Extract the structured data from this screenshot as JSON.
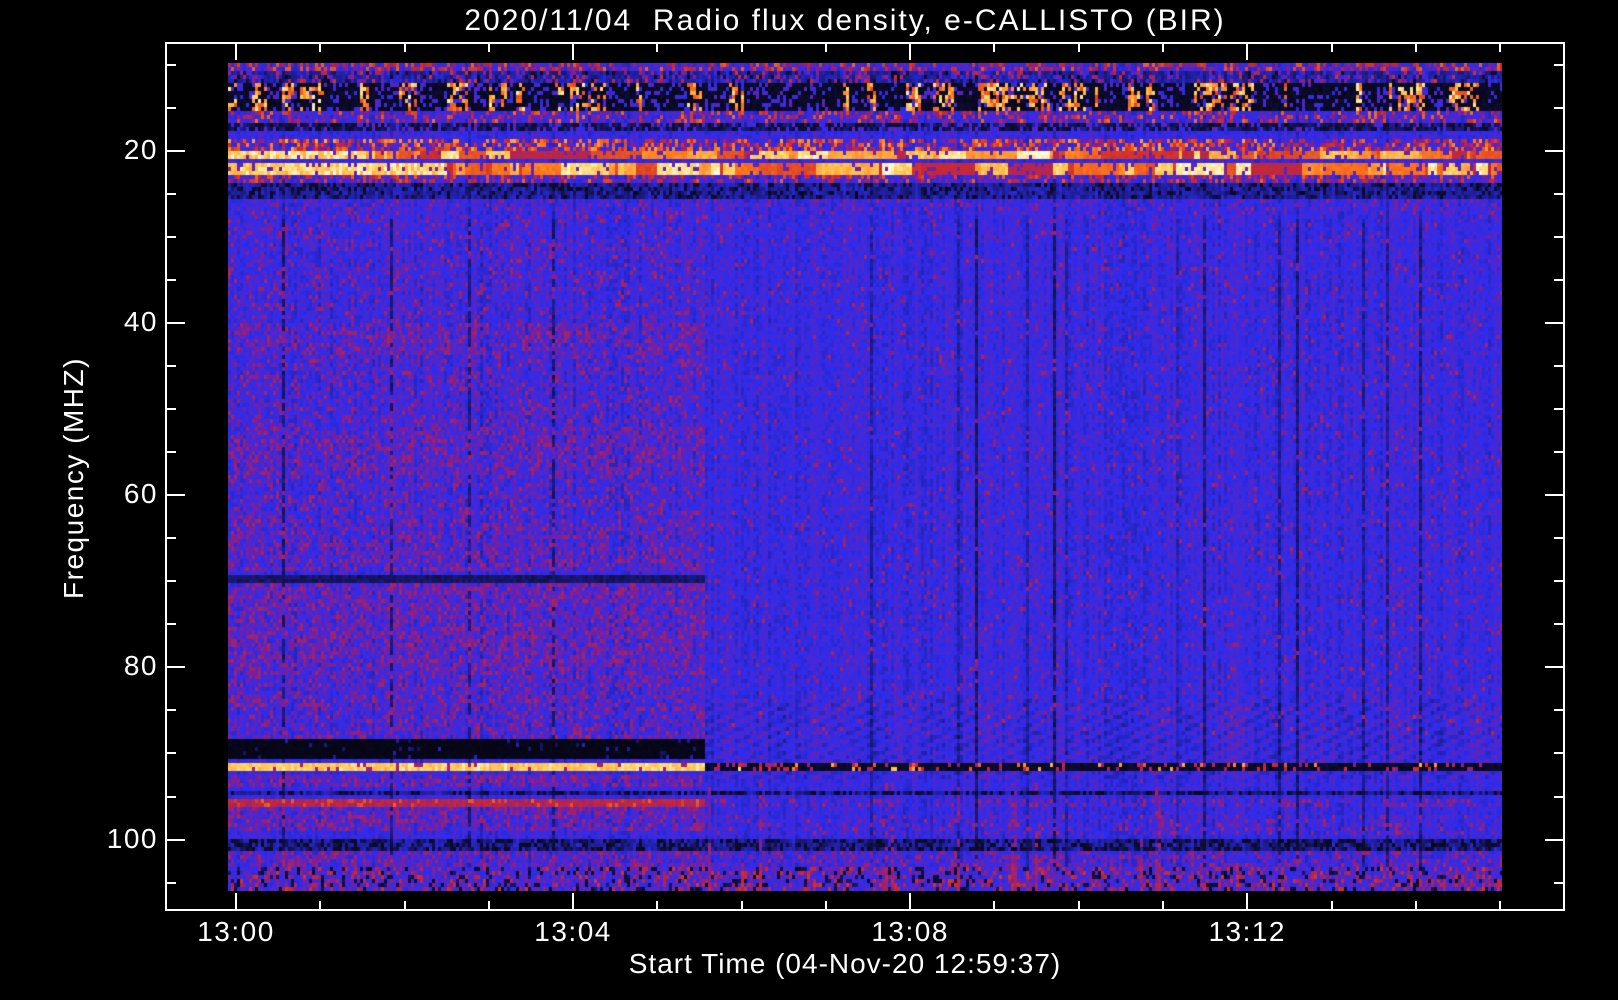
{
  "title": "2020/11/04  Radio flux density, e-CALLISTO (BIR)",
  "plot": {
    "x_axis": {
      "label": "Start Time (04-Nov-20 12:59:37)",
      "major_ticks": [
        {
          "minutes": 0,
          "label": "13:00"
        },
        {
          "minutes": 4,
          "label": "13:04"
        },
        {
          "minutes": 8,
          "label": "13:08"
        },
        {
          "minutes": 12,
          "label": "13:12"
        }
      ],
      "minor_tick_minutes": [
        1,
        2,
        3,
        5,
        6,
        7,
        9,
        10,
        11,
        13,
        14,
        15
      ]
    },
    "y_axis": {
      "label": "Frequency (MHZ)",
      "major_tick_values": [
        20,
        40,
        60,
        80,
        100
      ],
      "minor_tick_values": [
        10,
        15,
        25,
        30,
        35,
        45,
        50,
        55,
        65,
        70,
        75,
        85,
        90,
        95,
        105
      ]
    }
  },
  "colors": {
    "background": "#000000",
    "frame": "#ffffff",
    "text": "#ffffff",
    "quiet_blue": "#2e2cee",
    "mottle_purple": "#801e96",
    "red": "#cd2a2d",
    "orange": "#ff7a1a",
    "bright_yellow": "#ffd05c"
  },
  "chart_data": {
    "type": "heatmap",
    "title": "2020/11/04  Radio flux density, e-CALLISTO (BIR)",
    "xlabel": "Start Time (04-Nov-20 12:59:37)",
    "ylabel": "Frequency (MHZ)",
    "x_tick_labels": [
      "13:00",
      "13:04",
      "13:08",
      "13:12"
    ],
    "y_tick_values": [
      20,
      40,
      60,
      80,
      100
    ],
    "y_range_mhz": [
      10,
      106
    ],
    "y_axis_inverted": true,
    "x_start_minutes": -0.1,
    "x_span_minutes": 15.1,
    "boundary_minutes": 5.55,
    "background": "quiet blue continuum with vertical scan striping",
    "colormap_stops": [
      {
        "v": 0.0,
        "rgb": [
          4,
          4,
          14
        ]
      },
      {
        "v": 0.18,
        "rgb": [
          14,
          14,
          55
        ]
      },
      {
        "v": 0.4,
        "rgb": [
          46,
          44,
          238
        ]
      },
      {
        "v": 0.55,
        "rgb": [
          128,
          30,
          150
        ]
      },
      {
        "v": 0.68,
        "rgb": [
          205,
          42,
          45
        ]
      },
      {
        "v": 0.82,
        "rgb": [
          255,
          122,
          26
        ]
      },
      {
        "v": 0.93,
        "rgb": [
          255,
          208,
          92
        ]
      },
      {
        "v": 1.0,
        "rgb": [
          255,
          250,
          214
        ]
      }
    ],
    "bands": [
      {
        "f": [
          10.0,
          10.7
        ],
        "side": "F",
        "type": "speck",
        "p": 0.55,
        "v": [
          0.45,
          0.78
        ]
      },
      {
        "f": [
          10.7,
          12.3
        ],
        "side": "F",
        "type": "speck",
        "p": 0.32,
        "v": [
          0.5,
          0.8
        ]
      },
      {
        "f": [
          10.7,
          12.3
        ],
        "side": "F",
        "type": "darksp",
        "p": 0.1
      },
      {
        "f": [
          12.3,
          15.3
        ],
        "side": "F",
        "type": "rfidark"
      },
      {
        "f": [
          15.3,
          16.6
        ],
        "side": "F",
        "type": "speck",
        "p": 0.45,
        "v": [
          0.45,
          0.8
        ]
      },
      {
        "f": [
          16.6,
          17.8
        ],
        "side": "F",
        "type": "darkband"
      },
      {
        "f": [
          18.6,
          19.9
        ],
        "side": "F",
        "type": "speck",
        "p": 0.6,
        "v": [
          0.5,
          0.88
        ]
      },
      {
        "f": [
          19.9,
          20.8
        ],
        "side": "F",
        "type": "bright"
      },
      {
        "f": [
          21.5,
          22.7
        ],
        "side": "F",
        "type": "bright"
      },
      {
        "f": [
          22.7,
          23.9
        ],
        "side": "F",
        "type": "speck",
        "p": 0.5,
        "v": [
          0.48,
          0.78
        ]
      },
      {
        "f": [
          23.9,
          25.4
        ],
        "side": "F",
        "type": "darksp",
        "p": 0.3
      },
      {
        "f": [
          25.4,
          26.8
        ],
        "side": "F",
        "type": "speck",
        "p": 0.22,
        "v": [
          0.45,
          0.6
        ]
      },
      {
        "f": [
          27.0,
          40.0
        ],
        "side": "L",
        "type": "mottle",
        "p": 0.22
      },
      {
        "f": [
          40.0,
          44.0
        ],
        "side": "L",
        "type": "mottle",
        "p": 0.5
      },
      {
        "f": [
          44.0,
          52.0
        ],
        "side": "L",
        "type": "mottle",
        "p": 0.28
      },
      {
        "f": [
          52.0,
          58.0
        ],
        "side": "L",
        "type": "mottle",
        "p": 0.5
      },
      {
        "f": [
          58.0,
          63.0
        ],
        "side": "L",
        "type": "mottle",
        "p": 0.3
      },
      {
        "f": [
          63.0,
          69.0
        ],
        "side": "L",
        "type": "mottle",
        "p": 0.45
      },
      {
        "f": [
          69.3,
          70.3
        ],
        "side": "L",
        "type": "darkline"
      },
      {
        "f": [
          70.5,
          80.0
        ],
        "side": "L",
        "type": "mottle",
        "p": 0.55
      },
      {
        "f": [
          80.0,
          88.3
        ],
        "side": "L",
        "type": "mottle",
        "p": 0.4
      },
      {
        "f": [
          27.0,
          88.0
        ],
        "side": "R",
        "type": "mottle",
        "p": 0.08
      },
      {
        "f": [
          84.0,
          93.0
        ],
        "side": "R",
        "type": "moire"
      },
      {
        "f": [
          88.3,
          90.7
        ],
        "side": "L",
        "type": "black"
      },
      {
        "f": [
          91.1,
          92.4
        ],
        "side": "L",
        "type": "brightband"
      },
      {
        "f": [
          91.1,
          92.4
        ],
        "side": "R",
        "type": "blackspeck"
      },
      {
        "f": [
          92.6,
          94.2
        ],
        "side": "L",
        "type": "mottle",
        "p": 0.6
      },
      {
        "f": [
          94.4,
          95.2
        ],
        "side": "F",
        "type": "darksp",
        "p": 0.45
      },
      {
        "f": [
          95.6,
          96.4
        ],
        "side": "L",
        "type": "redband"
      },
      {
        "f": [
          95.6,
          96.4
        ],
        "side": "R",
        "type": "mottle",
        "p": 0.3
      },
      {
        "f": [
          96.6,
          99.2
        ],
        "side": "L",
        "type": "mottle",
        "p": 0.55
      },
      {
        "f": [
          97.5,
          99.5
        ],
        "side": "R",
        "type": "mottle",
        "p": 0.2
      },
      {
        "f": [
          100.2,
          101.4
        ],
        "side": "F",
        "type": "darksp",
        "p": 0.5
      },
      {
        "f": [
          101.6,
          103.4
        ],
        "side": "L",
        "type": "mottle",
        "p": 0.5
      },
      {
        "f": [
          101.6,
          103.4
        ],
        "side": "R",
        "type": "mottle",
        "p": 0.35
      },
      {
        "f": [
          103.6,
          106.01
        ],
        "side": "F",
        "type": "bottom"
      }
    ]
  }
}
